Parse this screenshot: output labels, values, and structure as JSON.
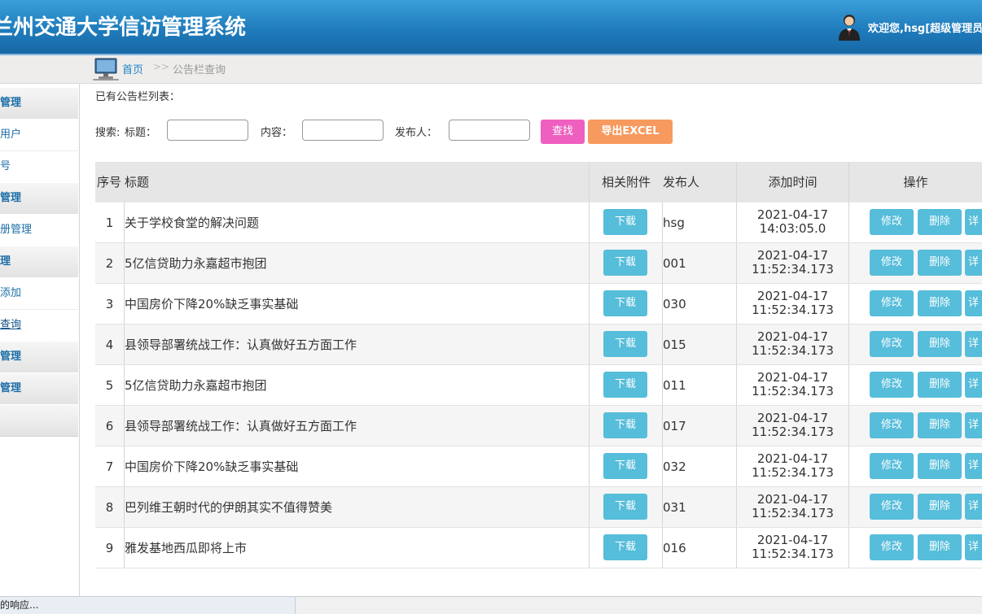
{
  "header": {
    "system_title": "兰州交通大学信访管理系统",
    "welcome": "欢迎您,hsg[超级管理员]"
  },
  "breadcrumb": {
    "home": "首页",
    "separator": ">>",
    "current": "公告栏查询"
  },
  "sidebar": {
    "items": [
      {
        "label": "管理",
        "type": "group"
      },
      {
        "label": "用户",
        "type": "sub"
      },
      {
        "label": "号",
        "type": "sub"
      },
      {
        "label": "管理",
        "type": "group"
      },
      {
        "label": "册管理",
        "type": "sub"
      },
      {
        "label": "理",
        "type": "group"
      },
      {
        "label": "添加",
        "type": "sub"
      },
      {
        "label": "查询",
        "type": "sub",
        "active": true
      },
      {
        "label": "管理",
        "type": "group"
      },
      {
        "label": "管理",
        "type": "group"
      },
      {
        "label": "",
        "type": "group"
      }
    ]
  },
  "main": {
    "list_title": "已有公告栏列表：",
    "search": {
      "label": "搜索:",
      "title_label": "标题：",
      "title_value": "",
      "content_label": "内容：",
      "content_value": "",
      "publisher_label": "发布人：",
      "publisher_value": "",
      "search_button": "查找",
      "export_button": "导出EXCEL"
    },
    "table": {
      "headers": {
        "index": "序号",
        "title": "标题",
        "attachment": "相关附件",
        "publisher": "发布人",
        "time": "添加时间",
        "ops": "操作"
      },
      "rows": [
        {
          "index": "1",
          "title": "关于学校食堂的解决问题",
          "download": "下载",
          "publisher": "hsg",
          "date": "2021-04-17",
          "time": "14:03:05.0",
          "edit": "修改",
          "delete": "删除",
          "detail": "详"
        },
        {
          "index": "2",
          "title": "5亿信贷助力永嘉超市抱团",
          "download": "下载",
          "publisher": "001",
          "date": "2021-04-17",
          "time": "11:52:34.173",
          "edit": "修改",
          "delete": "删除",
          "detail": "详"
        },
        {
          "index": "3",
          "title": "中国房价下降20%缺乏事实基础",
          "download": "下载",
          "publisher": "030",
          "date": "2021-04-17",
          "time": "11:52:34.173",
          "edit": "修改",
          "delete": "删除",
          "detail": "详"
        },
        {
          "index": "4",
          "title": "县领导部署统战工作：认真做好五方面工作",
          "download": "下载",
          "publisher": "015",
          "date": "2021-04-17",
          "time": "11:52:34.173",
          "edit": "修改",
          "delete": "删除",
          "detail": "详"
        },
        {
          "index": "5",
          "title": "5亿信贷助力永嘉超市抱团",
          "download": "下载",
          "publisher": "011",
          "date": "2021-04-17",
          "time": "11:52:34.173",
          "edit": "修改",
          "delete": "删除",
          "detail": "详"
        },
        {
          "index": "6",
          "title": "县领导部署统战工作：认真做好五方面工作",
          "download": "下载",
          "publisher": "017",
          "date": "2021-04-17",
          "time": "11:52:34.173",
          "edit": "修改",
          "delete": "删除",
          "detail": "详"
        },
        {
          "index": "7",
          "title": "中国房价下降20%缺乏事实基础",
          "download": "下载",
          "publisher": "032",
          "date": "2021-04-17",
          "time": "11:52:34.173",
          "edit": "修改",
          "delete": "删除",
          "detail": "详"
        },
        {
          "index": "8",
          "title": "巴列维王朝时代的伊朗其实不值得赞美",
          "download": "下载",
          "publisher": "031",
          "date": "2021-04-17",
          "time": "11:52:34.173",
          "edit": "修改",
          "delete": "删除",
          "detail": "详"
        },
        {
          "index": "9",
          "title": "雅发基地西瓜即将上市",
          "download": "下载",
          "publisher": "016",
          "date": "2021-04-17",
          "time": "11:52:34.173",
          "edit": "修改",
          "delete": "删除",
          "detail": "详"
        }
      ]
    }
  },
  "statusbar": {
    "text": "的响应..."
  },
  "colors": {
    "header": "#1f7cbc",
    "search_button": "#ef5fbf",
    "export_button": "#f79a5f",
    "action_button": "#56bdda",
    "link": "#1e84c4"
  }
}
